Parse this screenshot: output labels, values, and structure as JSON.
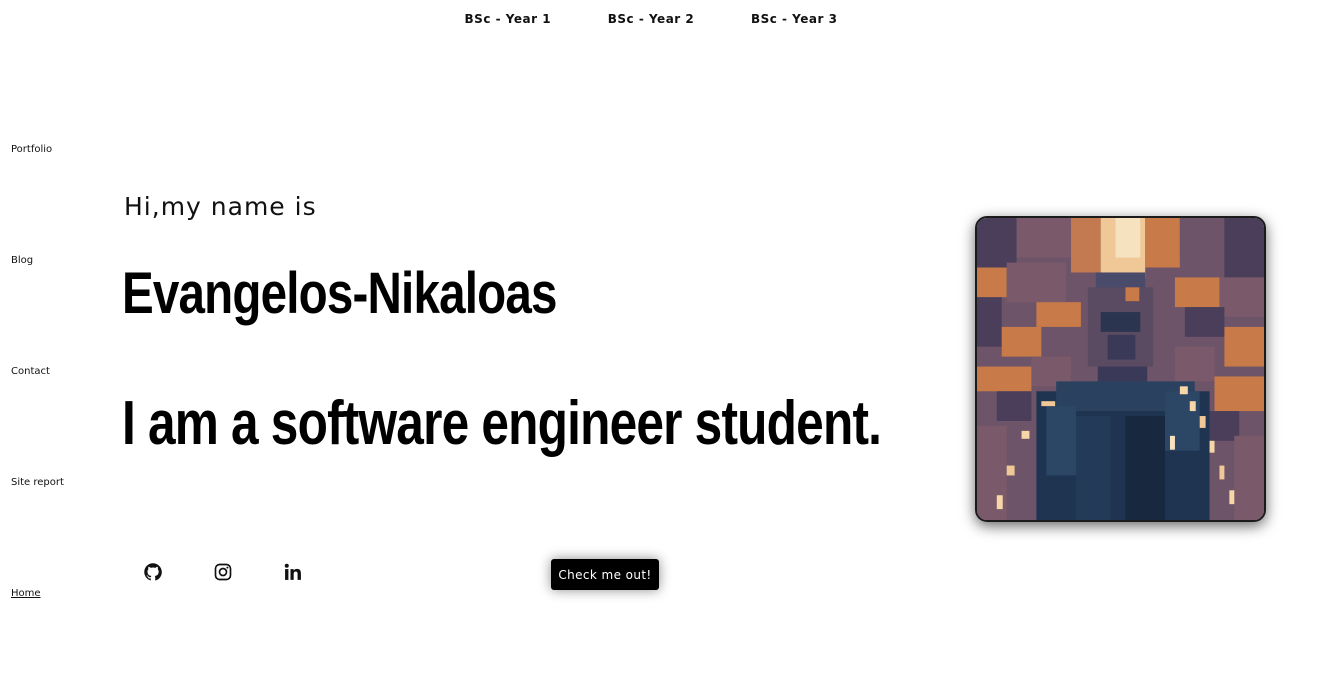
{
  "top_nav": [
    "BSc - Year 1",
    "BSc - Year 2",
    "BSc - Year 3"
  ],
  "side_nav": {
    "portfolio": "Portfolio",
    "blog": "Blog",
    "contact": "Contact",
    "site_report": "Site report",
    "home": "Home"
  },
  "hero": {
    "greeting": "Hi,my name is",
    "name": "Evangelos-Nikaloas",
    "tagline": "I am a software engineer student."
  },
  "social": {
    "github": "github-icon",
    "instagram": "instagram-icon",
    "linkedin": "linkedin-icon"
  },
  "cta_label": "Check me out!",
  "colors": {
    "text": "#000000",
    "button_bg": "#000000",
    "button_text": "#ffffff",
    "avatar_dark": "#1e3450",
    "avatar_mid": "#7a5a6a",
    "avatar_orange": "#c87a48",
    "avatar_light": "#f7d7a8"
  }
}
